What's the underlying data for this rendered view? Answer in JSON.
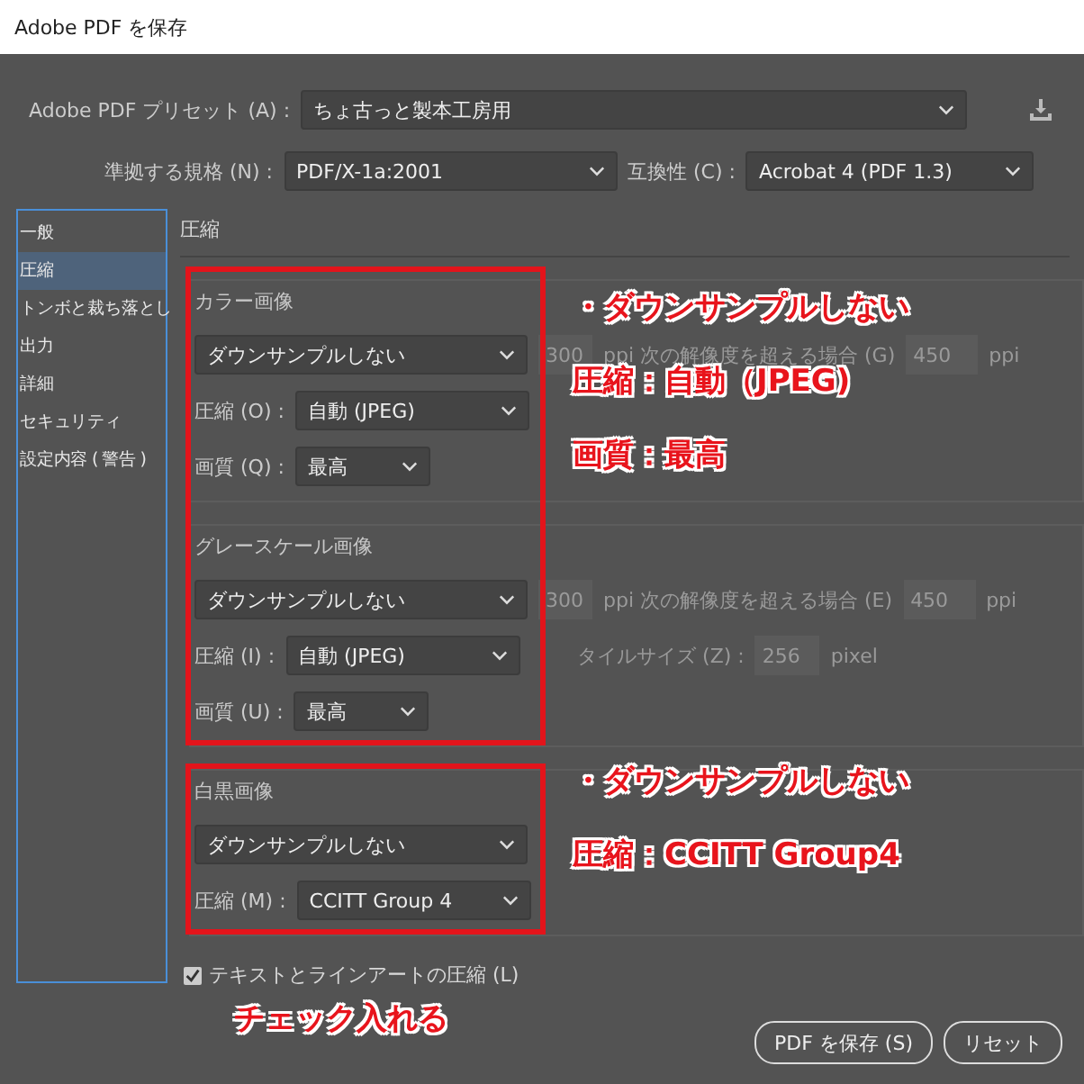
{
  "window": {
    "title": "Adobe PDF を保存"
  },
  "preset": {
    "label": "Adobe PDF プリセット (A) :",
    "value": "ちょ古っと製本工房用"
  },
  "standard": {
    "label": "準拠する規格 (N) :",
    "value": "PDF/X-1a:2001"
  },
  "compatibility": {
    "label": "互換性 (C) :",
    "value": "Acrobat 4 (PDF 1.3)"
  },
  "sidebar": {
    "items": [
      {
        "label": "一般",
        "selected": false
      },
      {
        "label": "圧縮",
        "selected": true
      },
      {
        "label": "トンボと裁ち落とし",
        "selected": false
      },
      {
        "label": "出力",
        "selected": false
      },
      {
        "label": "詳細",
        "selected": false
      },
      {
        "label": "セキュリティ",
        "selected": false
      },
      {
        "label": "設定内容 ( 警告 )",
        "selected": false
      }
    ]
  },
  "panel": {
    "title": "圧縮",
    "groups": [
      {
        "title": "カラー画像",
        "downsample": "ダウンサンプルしない",
        "resolution": {
          "disabled": true,
          "value": "300",
          "text": "ppi 次の解像度を超える場合 (G)",
          "threshold": "450",
          "unit": "ppi"
        },
        "compression": {
          "label": "圧縮 (O) :",
          "value": "自動 (JPEG)"
        },
        "quality": {
          "label": "画質 (Q) :",
          "value": "最高"
        }
      },
      {
        "title": "グレースケール画像",
        "downsample": "ダウンサンプルしない",
        "resolution": {
          "disabled": true,
          "value": "300",
          "text": "ppi 次の解像度を超える場合 (E)",
          "threshold": "450",
          "unit": "ppi"
        },
        "compression": {
          "label": "圧縮 (I) :",
          "value": "自動 (JPEG)"
        },
        "tile_size": {
          "disabled": true,
          "label": "タイルサイズ (Z) :",
          "value": "256",
          "unit": "pixel"
        },
        "quality": {
          "label": "画質 (U) :",
          "value": "最高"
        }
      },
      {
        "title": "白黒画像",
        "downsample": "ダウンサンプルしない",
        "compression": {
          "label": "圧縮 (M) :",
          "value": "CCITT Group 4"
        }
      }
    ],
    "checkbox": {
      "label": "テキストとラインアートの圧縮 (L)",
      "checked": true
    }
  },
  "buttons": [
    "PDF を保存 (S)",
    "リセット"
  ],
  "annotations": [
    {
      "lines": [
        "・ダウンサンプルしない",
        "圧縮：自動（JPEG)",
        "画質：最高"
      ]
    },
    {
      "lines": [
        "・ダウンサンプルしない",
        "圧縮：CCITT Group4"
      ]
    },
    {
      "lines": [
        "チェック入れる"
      ]
    }
  ]
}
